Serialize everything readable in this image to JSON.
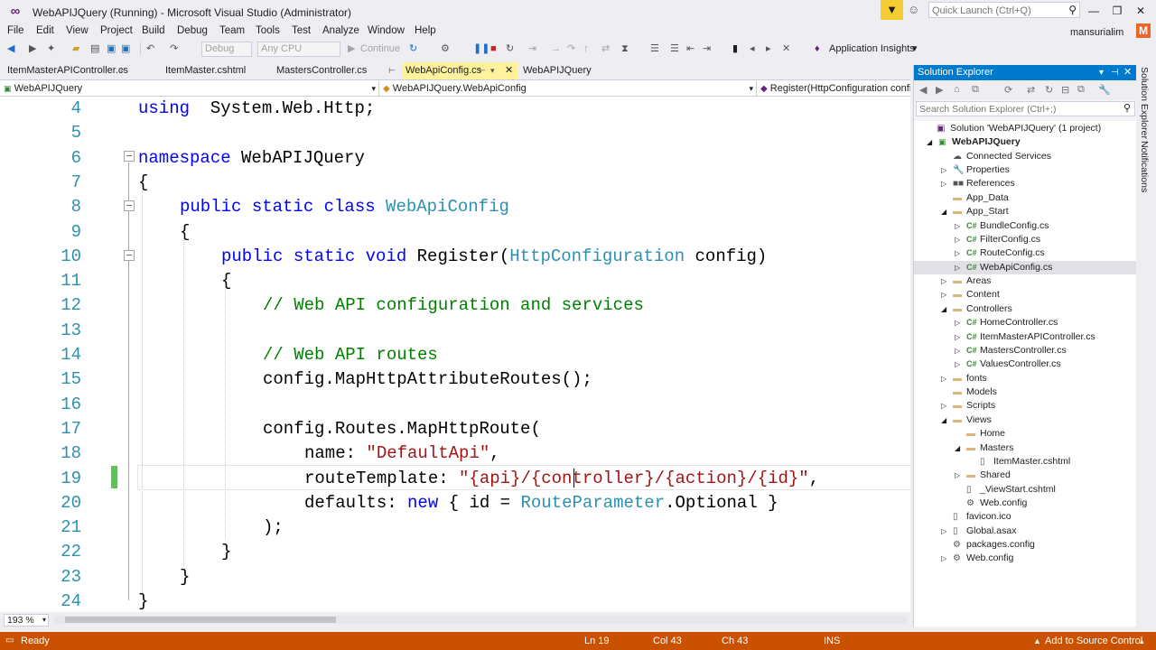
{
  "window": {
    "title": "WebAPIJQuery (Running) - Microsoft Visual Studio  (Administrator)",
    "quick_launch_placeholder": "Quick Launch (Ctrl+Q)",
    "user": "mansurialim",
    "avatar_initial": "M"
  },
  "menu": [
    "File",
    "Edit",
    "View",
    "Project",
    "Build",
    "Debug",
    "Team",
    "Tools",
    "Test",
    "Analyze",
    "Window",
    "Help"
  ],
  "toolbar": {
    "config": "Debug",
    "platform": "Any CPU",
    "continue": "Continue",
    "insights": "Application Insights"
  },
  "tabs": [
    {
      "label": "ItemMasterAPIController.cs",
      "active": false
    },
    {
      "label": "ItemMaster.cshtml",
      "active": false
    },
    {
      "label": "MastersController.cs",
      "active": false
    },
    {
      "label": "WebApiConfig.cs",
      "active": true
    },
    {
      "label": "WebAPIJQuery",
      "active": false
    }
  ],
  "navbar": {
    "project": "WebAPIJQuery",
    "class": "WebAPIJQuery.WebApiConfig",
    "member": "Register(HttpConfiguration config)"
  },
  "editor": {
    "lines": [
      {
        "n": "4",
        "indent": 0,
        "tokens": [
          [
            "kw",
            "using"
          ],
          [
            "",
            "  System.Web.Http;"
          ]
        ]
      },
      {
        "n": "5",
        "indent": 0,
        "tokens": []
      },
      {
        "n": "6",
        "indent": 0,
        "tokens": [
          [
            "kw",
            "namespace"
          ],
          [
            "",
            " WebAPIJQuery"
          ]
        ]
      },
      {
        "n": "7",
        "indent": 0,
        "tokens": [
          [
            "",
            "{"
          ]
        ]
      },
      {
        "n": "8",
        "indent": 1,
        "tokens": [
          [
            "kw",
            "public static class"
          ],
          [
            "",
            " "
          ],
          [
            "ty",
            "WebApiConfig"
          ]
        ]
      },
      {
        "n": "9",
        "indent": 1,
        "tokens": [
          [
            "",
            "{"
          ]
        ]
      },
      {
        "n": "10",
        "indent": 2,
        "tokens": [
          [
            "kw",
            "public static void"
          ],
          [
            "",
            " Register("
          ],
          [
            "ty",
            "HttpConfiguration"
          ],
          [
            "",
            " config)"
          ]
        ]
      },
      {
        "n": "11",
        "indent": 2,
        "tokens": [
          [
            "",
            "{"
          ]
        ]
      },
      {
        "n": "12",
        "indent": 3,
        "tokens": [
          [
            "cm",
            "// Web API configuration and services"
          ]
        ]
      },
      {
        "n": "13",
        "indent": 0,
        "tokens": []
      },
      {
        "n": "14",
        "indent": 3,
        "tokens": [
          [
            "cm",
            "// Web API routes"
          ]
        ]
      },
      {
        "n": "15",
        "indent": 3,
        "tokens": [
          [
            "",
            "config.MapHttpAttributeRoutes();"
          ]
        ]
      },
      {
        "n": "16",
        "indent": 0,
        "tokens": []
      },
      {
        "n": "17",
        "indent": 3,
        "tokens": [
          [
            "",
            "config.Routes.MapHttpRoute("
          ]
        ]
      },
      {
        "n": "18",
        "indent": 4,
        "tokens": [
          [
            "",
            "name: "
          ],
          [
            "st",
            "\"DefaultApi\""
          ],
          [
            "",
            ","
          ]
        ]
      },
      {
        "n": "19",
        "indent": 4,
        "tokens": [
          [
            "",
            "routeTemplate: "
          ],
          [
            "st",
            "\"{api}/{controller}/{action}/{id}\""
          ],
          [
            "",
            ","
          ]
        ]
      },
      {
        "n": "20",
        "indent": 4,
        "tokens": [
          [
            "",
            "defaults: "
          ],
          [
            "kw",
            "new"
          ],
          [
            "",
            " { id = "
          ],
          [
            "ty",
            "RouteParameter"
          ],
          [
            "",
            ".Optional }"
          ]
        ]
      },
      {
        "n": "21",
        "indent": 3,
        "tokens": [
          [
            "",
            ");"
          ]
        ]
      },
      {
        "n": "22",
        "indent": 2,
        "tokens": [
          [
            "",
            "}"
          ]
        ]
      },
      {
        "n": "23",
        "indent": 1,
        "tokens": [
          [
            "",
            "}"
          ]
        ]
      },
      {
        "n": "24",
        "indent": 0,
        "tokens": [
          [
            "",
            "}"
          ]
        ]
      }
    ],
    "zoom": "193 %"
  },
  "solution_explorer": {
    "title": "Solution Explorer",
    "search_placeholder": "Search Solution Explorer (Ctrl+;)",
    "items": [
      {
        "label": "Solution 'WebAPIJQuery' (1 project)",
        "level": 0,
        "arrow": "",
        "icon": "solution",
        "bold": false
      },
      {
        "label": "WebAPIJQuery",
        "level": 0,
        "arrow": "open",
        "icon": "project",
        "bold": true
      },
      {
        "label": "Connected Services",
        "level": 1,
        "arrow": "",
        "icon": "services",
        "bold": false
      },
      {
        "label": "Properties",
        "level": 1,
        "arrow": "closed",
        "icon": "wrench",
        "bold": false
      },
      {
        "label": "References",
        "level": 1,
        "arrow": "closed",
        "icon": "references",
        "bold": false
      },
      {
        "label": "App_Data",
        "level": 1,
        "arrow": "",
        "icon": "folder",
        "bold": false
      },
      {
        "label": "App_Start",
        "level": 1,
        "arrow": "open",
        "icon": "folder",
        "bold": false
      },
      {
        "label": "BundleConfig.cs",
        "level": 2,
        "arrow": "closed",
        "icon": "cs",
        "bold": false
      },
      {
        "label": "FilterConfig.cs",
        "level": 2,
        "arrow": "closed",
        "icon": "cs",
        "bold": false
      },
      {
        "label": "RouteConfig.cs",
        "level": 2,
        "arrow": "closed",
        "icon": "cs",
        "bold": false
      },
      {
        "label": "WebApiConfig.cs",
        "level": 2,
        "arrow": "closed",
        "icon": "cs",
        "bold": false,
        "selected": true
      },
      {
        "label": "Areas",
        "level": 1,
        "arrow": "closed",
        "icon": "folder",
        "bold": false
      },
      {
        "label": "Content",
        "level": 1,
        "arrow": "closed",
        "icon": "folder",
        "bold": false
      },
      {
        "label": "Controllers",
        "level": 1,
        "arrow": "open",
        "icon": "folder",
        "bold": false
      },
      {
        "label": "HomeController.cs",
        "level": 2,
        "arrow": "closed",
        "icon": "cs",
        "bold": false
      },
      {
        "label": "ItemMasterAPIController.cs",
        "level": 2,
        "arrow": "closed",
        "icon": "cs",
        "bold": false
      },
      {
        "label": "MastersController.cs",
        "level": 2,
        "arrow": "closed",
        "icon": "cs",
        "bold": false
      },
      {
        "label": "ValuesController.cs",
        "level": 2,
        "arrow": "closed",
        "icon": "cs",
        "bold": false
      },
      {
        "label": "fonts",
        "level": 1,
        "arrow": "closed",
        "icon": "folder",
        "bold": false
      },
      {
        "label": "Models",
        "level": 1,
        "arrow": "",
        "icon": "folder",
        "bold": false
      },
      {
        "label": "Scripts",
        "level": 1,
        "arrow": "closed",
        "icon": "folder",
        "bold": false
      },
      {
        "label": "Views",
        "level": 1,
        "arrow": "open",
        "icon": "folder",
        "bold": false
      },
      {
        "label": "Home",
        "level": 2,
        "arrow": "",
        "icon": "folder",
        "bold": false
      },
      {
        "label": "Masters",
        "level": 2,
        "arrow": "open",
        "icon": "folder",
        "bold": false
      },
      {
        "label": "ItemMaster.cshtml",
        "level": 3,
        "arrow": "",
        "icon": "file",
        "bold": false
      },
      {
        "label": "Shared",
        "level": 2,
        "arrow": "closed",
        "icon": "folder",
        "bold": false
      },
      {
        "label": "_ViewStart.cshtml",
        "level": 2,
        "arrow": "",
        "icon": "file",
        "bold": false
      },
      {
        "label": "Web.config",
        "level": 2,
        "arrow": "",
        "icon": "config",
        "bold": false
      },
      {
        "label": "favicon.ico",
        "level": 1,
        "arrow": "",
        "icon": "file",
        "bold": false
      },
      {
        "label": "Global.asax",
        "level": 1,
        "arrow": "closed",
        "icon": "file",
        "bold": false
      },
      {
        "label": "packages.config",
        "level": 1,
        "arrow": "",
        "icon": "config",
        "bold": false
      },
      {
        "label": "Web.config",
        "level": 1,
        "arrow": "closed",
        "icon": "config",
        "bold": false
      }
    ]
  },
  "side_tabs": [
    "Solution Explorer",
    "Notifications"
  ],
  "status": {
    "state": "Ready",
    "line": "Ln 19",
    "col": "Col 43",
    "ch": "Ch 43",
    "mode": "INS",
    "source_control": "Add to Source Control"
  },
  "colors": {
    "accent": "#007acc",
    "status_bar": "#ca5100",
    "active_tab": "#fff29d",
    "keyword": "#0000ff",
    "type": "#2b91af",
    "comment": "#008000",
    "string": "#a31515"
  }
}
